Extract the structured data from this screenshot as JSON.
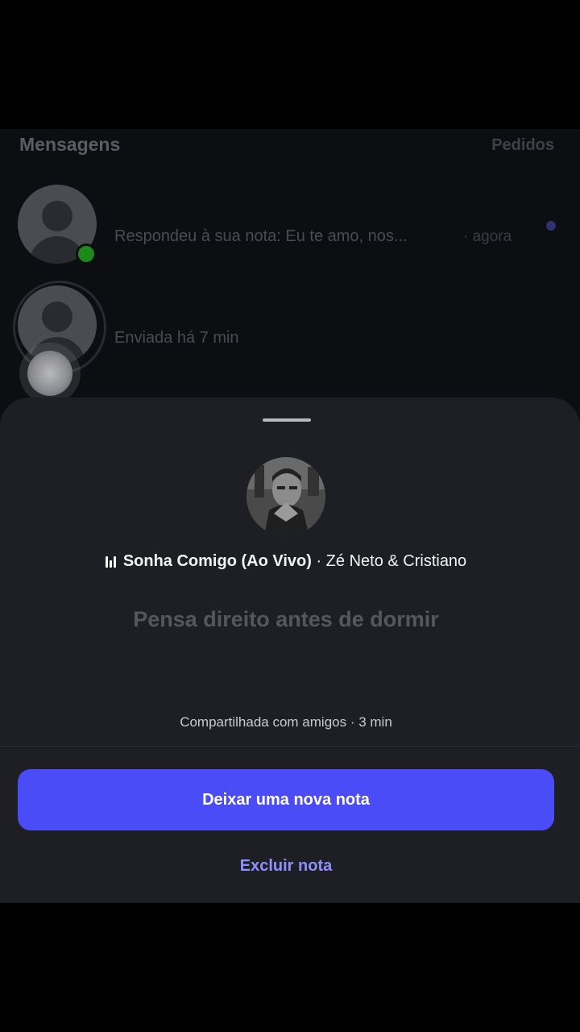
{
  "header": {
    "title": "Mensagens",
    "requests_link": "Pedidos"
  },
  "messages": [
    {
      "preview": "Respondeu à sua nota: Eu te amo, nos...",
      "time": "· agora",
      "online": true,
      "unread": true
    },
    {
      "preview": "Enviada há 7 min"
    }
  ],
  "note_sheet": {
    "music": {
      "song": "Sonha Comigo (Ao Vivo)",
      "artist": "· Zé Neto & Cristiano"
    },
    "note_text": "Pensa direito antes de dormir",
    "shared_info": "Compartilhada com amigos · 3 min",
    "primary_button": "Deixar uma nova nota",
    "delete_button": "Excluir nota"
  },
  "colors": {
    "accent": "#4a4cf7",
    "link": "#8e90ff",
    "sheet_bg": "#1e1f25",
    "online": "#1b8a1b"
  }
}
